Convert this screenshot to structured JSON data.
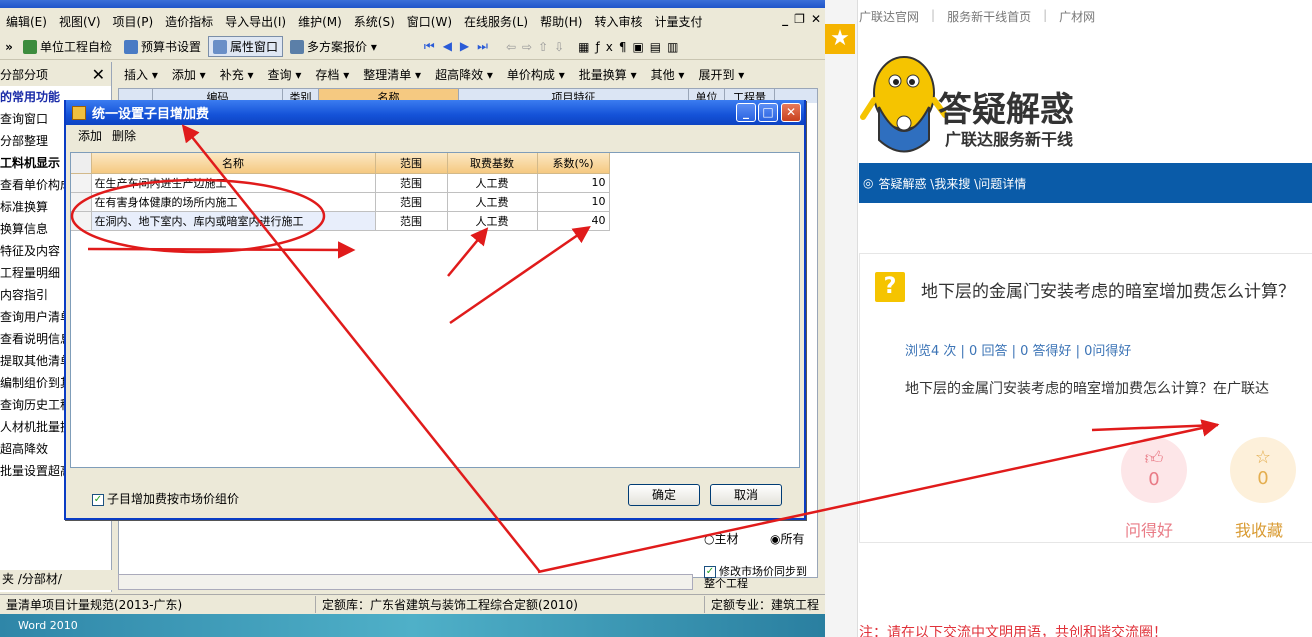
{
  "menubar": {
    "items": [
      "编辑(E)",
      "视图(V)",
      "项目(P)",
      "造价指标",
      "导入导出(I)",
      "维护(M)",
      "系统(S)",
      "窗口(W)",
      "在线服务(L)",
      "帮助(H)",
      "转入审核",
      "计量支付"
    ],
    "window_controls": [
      "_",
      "❐",
      "✕"
    ]
  },
  "toolbar1": {
    "items": [
      "单位工程自检",
      "预算书设置",
      "属性窗口",
      "多方案报价 ▾"
    ]
  },
  "toolbar2": {
    "items": [
      "插入 ▾",
      "添加 ▾",
      "补充 ▾",
      "查询 ▾",
      "存档 ▾",
      "整理清单 ▾",
      "超高降效 ▾",
      "单价构成 ▾",
      "批量换算 ▾",
      "其他 ▾",
      "展开到 ▾"
    ]
  },
  "left_panel": {
    "header": "分部分项",
    "close": "✕",
    "items": [
      "的常用功能",
      "查询窗口",
      "分部整理",
      "工料机显示",
      "查看单价构成",
      "标准换算",
      "换算信息",
      "特征及内容",
      "工程量明细",
      "内容指引",
      "查询用户清单",
      "查看说明信息",
      "提取其他清单",
      "编制组价到其",
      "查询历史工程",
      "人材机批量换",
      "超高降效",
      "批量设置超高"
    ],
    "tabs": "夹 /分部材/"
  },
  "grid": {
    "headers": [
      "",
      "编码",
      "类别",
      "名称",
      "项目特征",
      "单位",
      "工程量"
    ]
  },
  "right_props": {
    "radio_main": "主材",
    "radio_all": "所有",
    "check_sync": "修改市场价同步到整个工程"
  },
  "statusbar": {
    "seg1": "量清单项目计量规范(2013-广东)",
    "seg2": "定额库：广东省建筑与装饰工程综合定额(2010)",
    "seg3": "定额专业：建筑工程"
  },
  "desktop_label": "Word 2010",
  "dialog": {
    "title": "统一设置子目增加费",
    "toolbar": [
      "添加",
      "删除"
    ],
    "columns": [
      "名称",
      "范围",
      "取费基数",
      "系数(%)"
    ],
    "rows": [
      {
        "name": "在生产车间内进生产边施工",
        "scope": "范围",
        "base": "人工费",
        "rate": "10"
      },
      {
        "name": "在有害身体健康的场所内施工",
        "scope": "范围",
        "base": "人工费",
        "rate": "10"
      },
      {
        "name": "在洞内、地下室内、库内或暗室内进行施工",
        "scope": "范围",
        "base": "人工费",
        "rate": "40"
      }
    ],
    "checkbox_label": "子目增加费按市场价组价",
    "ok": "确定",
    "cancel": "取消"
  },
  "web": {
    "topnav": [
      "广联达官网",
      "服务新干线首页",
      "广材网"
    ],
    "logo_title": "答疑解惑",
    "logo_subtitle": "广联达服务新干线",
    "breadcrumb": "答疑解惑 \\我来搜 \\问题详情",
    "question_title": "地下层的金属门安装考虑的暗室增加费怎么计算？",
    "stats": "浏览4 次 | 0 回答 | 0 答得好 | 0问得好",
    "question_body": "地下层的金属门安装考虑的暗室增加费怎么计算？在广联达",
    "like_count": "0",
    "like_label": "问得好",
    "fav_count": "0",
    "fav_label": "我收藏",
    "warning": "注：请在以下交流中文明用语，共创和谐交流圈！"
  },
  "colors": {
    "annotation": "#e01b1b",
    "dialog_title": "#1452d8",
    "web_bar": "#0a5ba8"
  }
}
